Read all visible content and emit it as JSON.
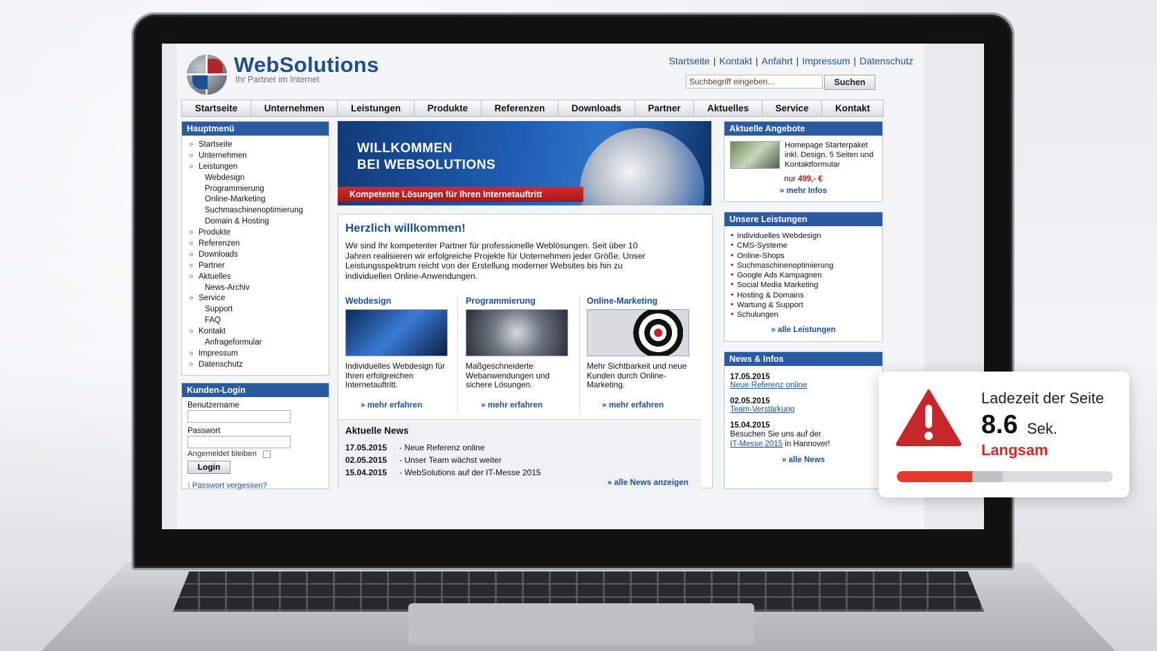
{
  "site": {
    "logo_title": "WebSolutions",
    "logo_subtitle": "Ihr Partner im Internet",
    "top_links": [
      "Startseite",
      "Kontakt",
      "Anfahrt",
      "Impressum",
      "Datenschutz"
    ],
    "search": {
      "placeholder": "Suchbegriff eingeben...",
      "button": "Suchen"
    },
    "nav": [
      "Startseite",
      "Unternehmen",
      "Leistungen",
      "Produkte",
      "Referenzen",
      "Downloads",
      "Partner",
      "Aktuelles",
      "Service",
      "Kontakt"
    ],
    "sidebar": {
      "title": "Hauptmenü",
      "items": [
        {
          "label": "Startseite",
          "level": 1
        },
        {
          "label": "Unternehmen",
          "level": 1
        },
        {
          "label": "Leistungen",
          "level": 1
        },
        {
          "label": "Webdesign",
          "level": 2
        },
        {
          "label": "Programmierung",
          "level": 2
        },
        {
          "label": "Online-Marketing",
          "level": 2
        },
        {
          "label": "Suchmaschinenoptimierung",
          "level": 2
        },
        {
          "label": "Domain & Hosting",
          "level": 2
        },
        {
          "label": "Produkte",
          "level": 1
        },
        {
          "label": "Referenzen",
          "level": 1
        },
        {
          "label": "Downloads",
          "level": 1
        },
        {
          "label": "Partner",
          "level": 1
        },
        {
          "label": "Aktuelles",
          "level": 1
        },
        {
          "label": "News-Archiv",
          "level": 2
        },
        {
          "label": "Service",
          "level": 1
        },
        {
          "label": "Support",
          "level": 2
        },
        {
          "label": "FAQ",
          "level": 2
        },
        {
          "label": "Kontakt",
          "level": 1
        },
        {
          "label": "Anfrageformular",
          "level": 2
        },
        {
          "label": "Impressum",
          "level": 1
        },
        {
          "label": "Datenschutz",
          "level": 1
        }
      ]
    },
    "login": {
      "title": "Kunden-Login",
      "username_label": "Benutzername",
      "password_label": "Passwort",
      "remember_label": "Angemeldet bleiben",
      "button": "Login",
      "forgot": "Passwort vergessen?"
    },
    "banner": {
      "line1": "WILLKOMMEN",
      "line2": "BEI WEBSOLUTIONS",
      "tagline": "Kompetente Lösungen für Ihren Internetauftritt"
    },
    "welcome": {
      "title": "Herzlich willkommen!",
      "text": "Wir sind Ihr kompetenter Partner für professionelle Weblösungen. Seit über 10 Jahren realisieren wir erfolgreiche Projekte für Unternehmen jeder Größe. Unser Leistungsspektrum reicht von der Erstellung moderner Websites bis hin zu individuellen Online-Anwendungen."
    },
    "columns": [
      {
        "title": "Webdesign",
        "text": "Individuelles Webdesign für Ihren erfolgreichen Internetauftritt.",
        "more": "» mehr erfahren"
      },
      {
        "title": "Programmierung",
        "text": "Maßgeschneiderte Webanwendungen und sichere Lösungen.",
        "more": "» mehr erfahren"
      },
      {
        "title": "Online-Marketing",
        "text": "Mehr Sichtbarkeit und neue Kunden durch Online-Marketing.",
        "more": "» mehr erfahren"
      }
    ],
    "news": {
      "title": "Aktuelle News",
      "rows": [
        {
          "date": "17.05.2015",
          "text": "- Neue Referenz online"
        },
        {
          "date": "02.05.2015",
          "text": "- Unser Team wächst weiter"
        },
        {
          "date": "15.04.2015",
          "text": "- WebSolutions auf der IT-Messe 2015"
        }
      ],
      "more": "» alle News anzeigen"
    },
    "offers": {
      "title": "Aktuelle Angebote",
      "text": "Homepage Starterpaket inkl. Design, 5 Seiten und Kontaktformular",
      "price_prefix": "nur",
      "price": "499,- €",
      "more": "» mehr Infos"
    },
    "services": {
      "title": "Unsere Leistungen",
      "items": [
        "Individuelles Webdesign",
        "CMS-Systeme",
        "Online-Shops",
        "Suchmaschinenoptimierung",
        "Google Ads Kampagnen",
        "Social Media Marketing",
        "Hosting & Domains",
        "Wartung & Support",
        "Schulungen"
      ],
      "more": "» alle Leistungen"
    },
    "news_info": {
      "title": "News & Infos",
      "items": [
        {
          "date": "17.05.2015",
          "link": "Neue Referenz online"
        },
        {
          "date": "02.05.2015",
          "link": "Team-Verstärkung"
        },
        {
          "date": "15.04.2015",
          "text": "Besuchen Sie uns auf der",
          "link": "IT-Messe 2015",
          "after": "in Hannover!"
        }
      ],
      "more": "» alle News"
    }
  },
  "overlay": {
    "title": "Ladezeit der Seite",
    "value": "8.6",
    "unit": "Sek.",
    "status": "Langsam",
    "status_color": "#d32a2a",
    "progress_fraction": 0.35,
    "icon": "warning-triangle-icon"
  }
}
